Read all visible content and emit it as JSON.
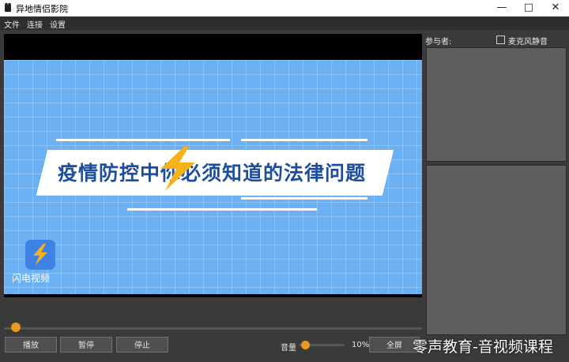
{
  "window": {
    "title": "异地情侣影院"
  },
  "menu": [
    "文件",
    "连接",
    "设置"
  ],
  "video": {
    "headline": "疫情防控中你必须知道的法律问题",
    "logo_caption": "闪电视频"
  },
  "playback": {
    "progress": 0.02
  },
  "controls": {
    "play": "播放",
    "pause": "暂停",
    "stop": "停止",
    "volume_label": "音量",
    "volume_percent": "10%",
    "fullscreen": "全屏"
  },
  "sidebar": {
    "participants_label": "参与者:",
    "mute_label": "麦克风静音",
    "mute_checked": false
  },
  "watermark": "零声教育-音视频课程",
  "colors": {
    "accent": "#e69a23",
    "video_bg": "#6ab0f2",
    "headline": "#1d4e9e"
  }
}
